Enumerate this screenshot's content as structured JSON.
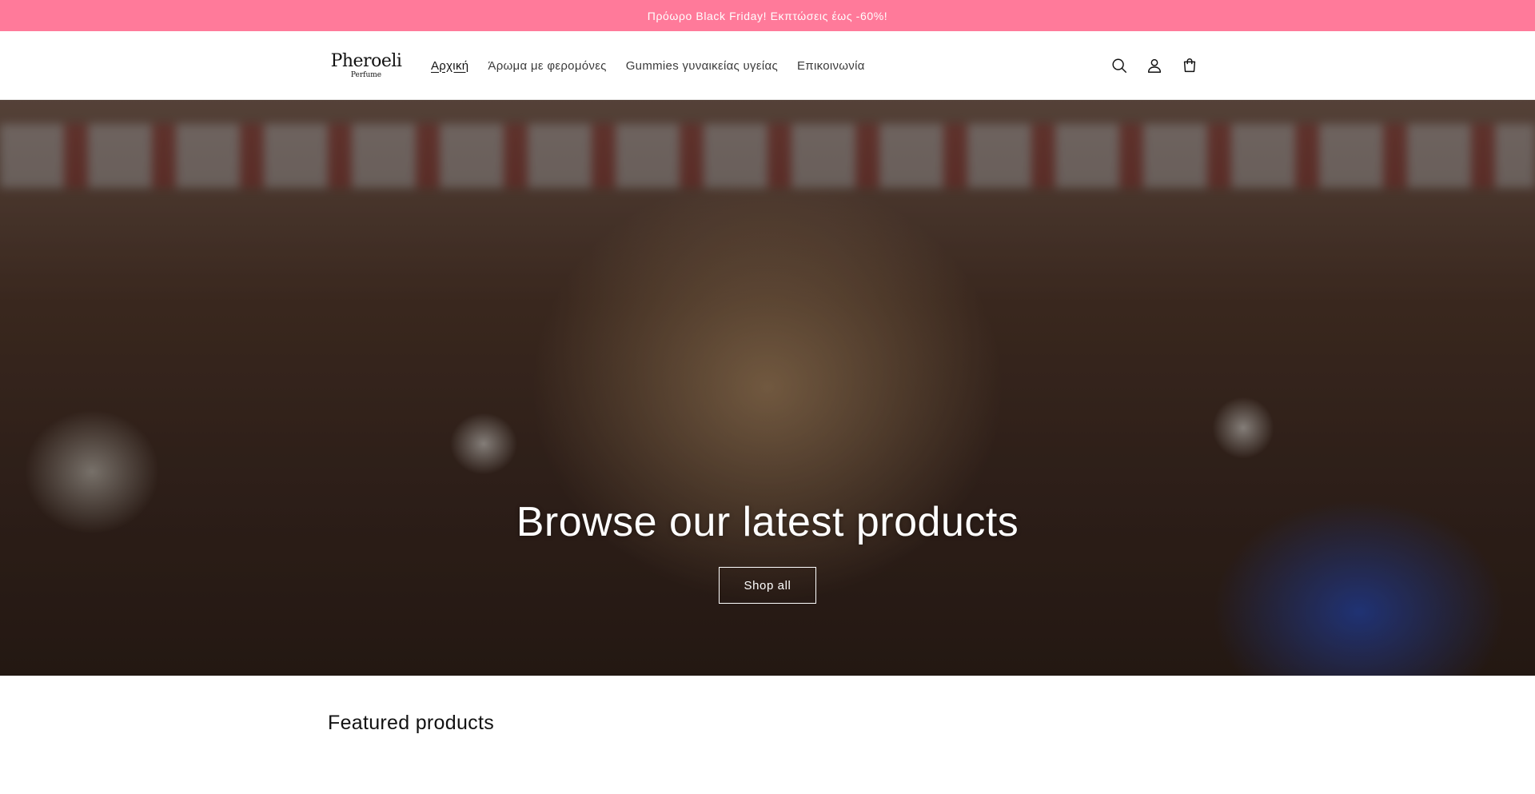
{
  "announcement": {
    "text": "Πρόωρο Black Friday! Εκπτώσεις έως -60%!"
  },
  "header": {
    "logo": {
      "main": "Pheroeli",
      "sub": "Perfume"
    },
    "nav": [
      {
        "label": "Αρχική",
        "active": true
      },
      {
        "label": "Άρωμα με φερομόνες",
        "active": false
      },
      {
        "label": "Gummies γυναικείας υγείας",
        "active": false
      },
      {
        "label": "Επικοινωνία",
        "active": false
      }
    ],
    "icons": [
      "search-icon",
      "account-icon",
      "cart-icon"
    ]
  },
  "hero": {
    "title": "Browse our latest products",
    "button_label": "Shop all"
  },
  "featured": {
    "title": "Featured products"
  },
  "colors": {
    "announcement_bg": "#ff7a9a",
    "text": "#121212"
  }
}
